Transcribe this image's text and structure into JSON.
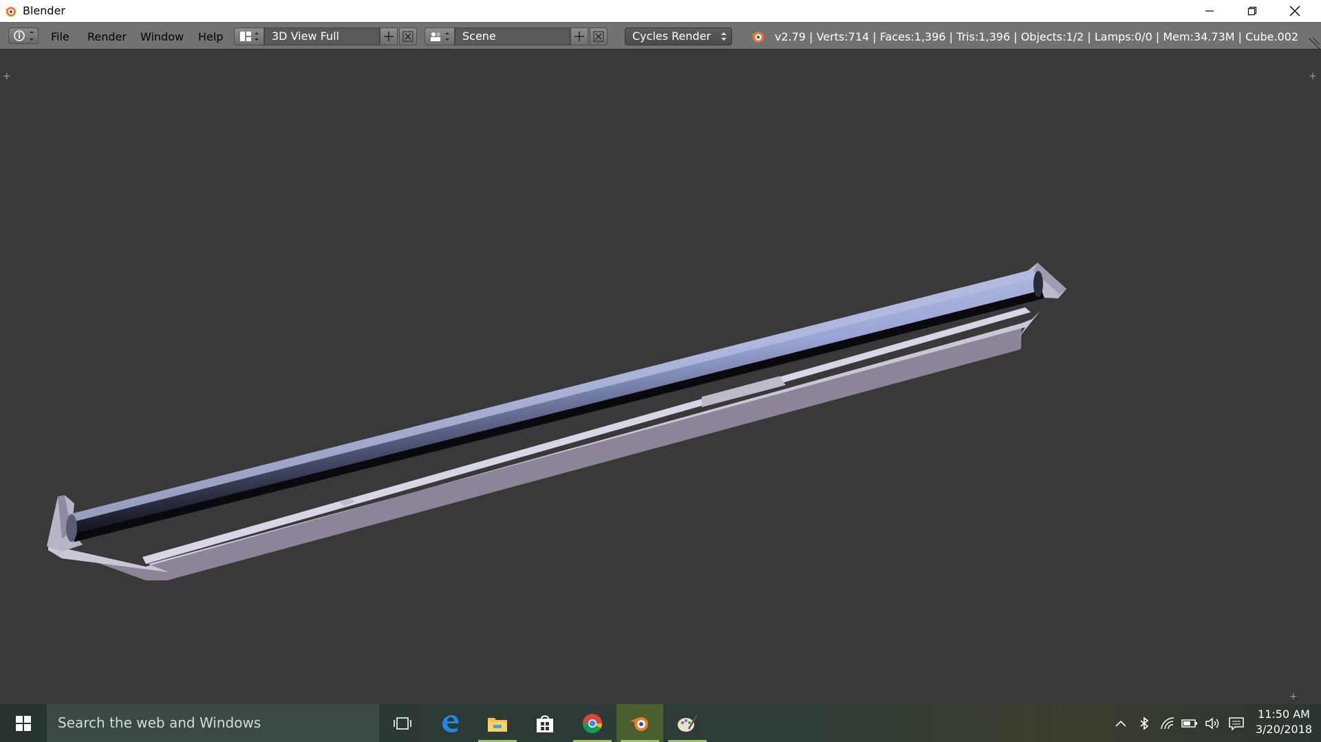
{
  "window": {
    "title": "Blender",
    "controls": [
      "minimize-icon",
      "restore-icon",
      "close-icon"
    ]
  },
  "header": {
    "menus": [
      "File",
      "Render",
      "Window",
      "Help"
    ],
    "screen_layout": "3D View Full",
    "scene": "Scene",
    "render_engine": "Cycles Render",
    "stats": "v2.79 | Verts:714 | Faces:1,396 | Tris:1,396 | Objects:1/2 | Lamps:0/0 | Mem:34.73M | Cube.002"
  },
  "viewport": {
    "background_color": "#393939",
    "object_colors": {
      "rod_light": "#aab4dc",
      "rod_dark": "#0d0d12",
      "tray_top": "#c9c7d6",
      "tray_side": "#8e8499"
    }
  },
  "taskbar": {
    "search_placeholder": "Search the web and Windows",
    "apps": [
      "task-view-icon",
      "edge-icon",
      "file-explorer-icon",
      "store-icon",
      "chrome-icon",
      "blender-icon",
      "paint-icon"
    ],
    "active_app": "blender-icon",
    "time": "11:50 AM",
    "date": "3/20/2018"
  }
}
